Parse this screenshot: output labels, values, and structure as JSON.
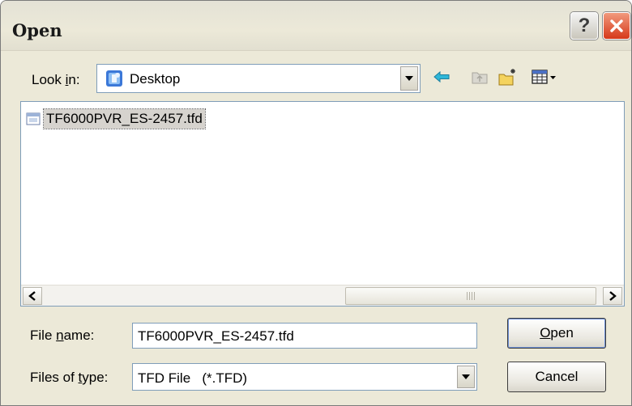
{
  "window": {
    "title": "Open",
    "help_glyph": "?",
    "close_icon": "close-icon"
  },
  "lookin": {
    "label_pre": "Look ",
    "label_accel": "i",
    "label_post": "n:",
    "value": "Desktop",
    "icon": "desktop-icon"
  },
  "toolbar": {
    "back_icon": "back-arrow-icon",
    "up_icon": "up-folder-icon",
    "new_folder_icon": "new-folder-icon",
    "views_icon": "views-menu-icon"
  },
  "files": [
    {
      "name": "TF6000PVR_ES-2457.tfd",
      "icon": "file-icon",
      "selected": true
    }
  ],
  "filename": {
    "label_pre": "File ",
    "label_accel": "n",
    "label_post": "ame:",
    "value": "TF6000PVR_ES-2457.tfd"
  },
  "filetype": {
    "label_pre": "Files of ",
    "label_accel": "t",
    "label_post": "ype:",
    "value": "TFD File   (*.TFD)"
  },
  "buttons": {
    "open_accel": "O",
    "open_rest": "pen",
    "cancel": "Cancel"
  },
  "colors": {
    "window_bg": "#ece9d8",
    "close_red": "#d6381a",
    "selection_bg": "#d6d3ce",
    "field_border": "#7f9db9"
  }
}
